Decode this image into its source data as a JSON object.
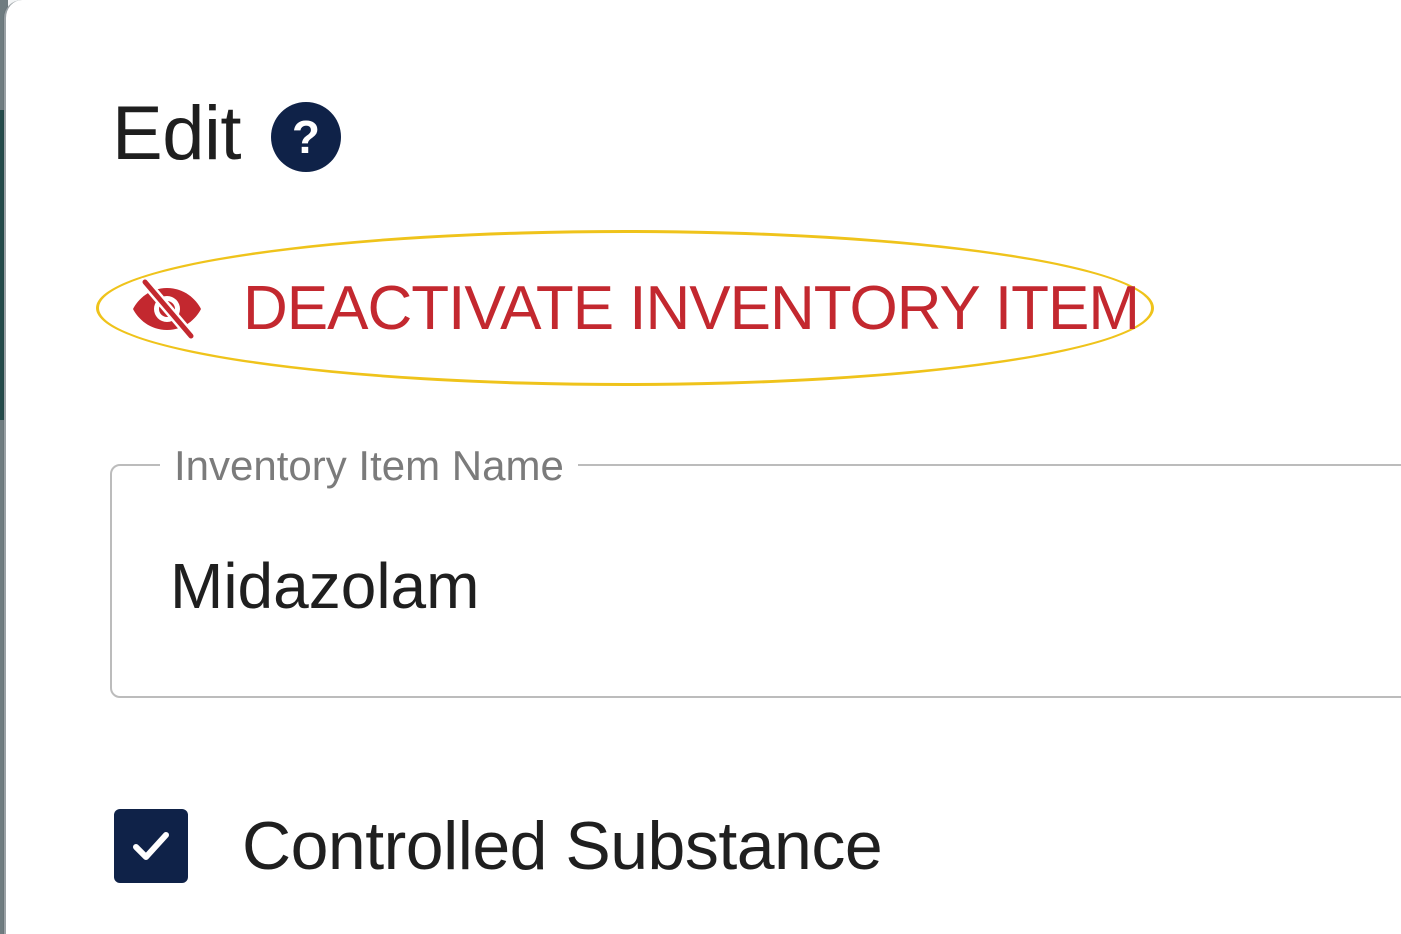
{
  "dialog": {
    "title": "Edit",
    "help_icon": "help-circle-icon",
    "help_glyph": "?"
  },
  "deactivate": {
    "icon": "eye-off-icon",
    "label": "DEACTIVATE INVENTORY ITEM"
  },
  "fields": {
    "inventory_item_name": {
      "label": "Inventory Item Name",
      "value": "Midazolam"
    }
  },
  "options": {
    "controlled_substance": {
      "label": "Controlled Substance",
      "checked": true,
      "checkbox_icon": "checkmark-icon"
    }
  },
  "colors": {
    "accent": "#0f2248",
    "danger": "#c3282f",
    "annotation": "#efc31b"
  }
}
